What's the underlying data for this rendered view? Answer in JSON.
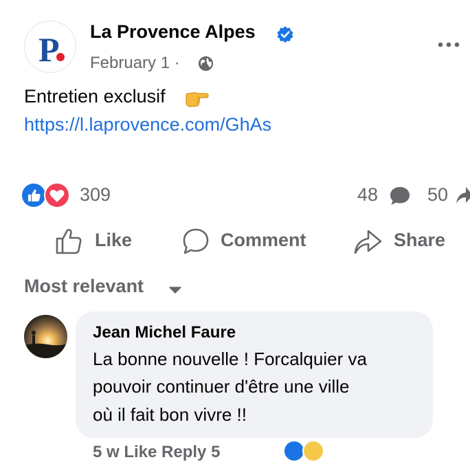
{
  "post": {
    "page_name": "La Provence Alpes",
    "logo_letter": "P",
    "date": "February 1 ·",
    "text": "Entretien exclusif",
    "link": "https://l.laprovence.com/GhAs"
  },
  "icons": {
    "verified": "verified-badge-icon",
    "audience": "globe-icon",
    "more": "more-options-icon",
    "emoji": "backhand-index-pointing-right-icon"
  },
  "reactions": {
    "count": "309",
    "comments_count": "48",
    "shares_count": "50"
  },
  "actions": {
    "like": "Like",
    "comment": "Comment",
    "share": "Share"
  },
  "comments_filter": "Most relevant",
  "comment": {
    "author": "Jean Michel Faure",
    "lines": [
      "La bonne nouvelle ! Forcalquier va",
      "pouvoir continuer d'être une ville",
      "où il fait bon vivre !!"
    ],
    "meta_partial": "5 w   Like   Reply   5"
  },
  "colors": {
    "accent_blue": "#216fdb",
    "like_blue": "#1b74e4",
    "love_red": "#f33e58",
    "secondary_text": "#65676b",
    "bubble_bg": "#f0f2f5",
    "logo_blue": "#1c4f9c",
    "logo_red": "#e0202c"
  }
}
